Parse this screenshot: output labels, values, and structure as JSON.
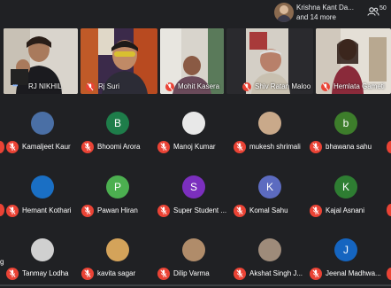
{
  "notification": {
    "title": "Krishna Kant Da...",
    "subtitle": "and 14 more"
  },
  "people_button": {
    "count": "50"
  },
  "video_tiles": [
    {
      "name": "RJ NIKHIL"
    },
    {
      "name": "Rj Suri"
    },
    {
      "name": "Mohit Kasera"
    },
    {
      "name": "Shiv Ratan Maloo"
    },
    {
      "name": "Hemlata Gameti"
    }
  ],
  "grid": [
    {
      "name": "Kamaljeet Kaur",
      "initial": "",
      "color": "#4a6fa5"
    },
    {
      "name": "Bhoomi Arora",
      "initial": "B",
      "color": "#1e7d4a"
    },
    {
      "name": "Manoj Kumar",
      "initial": "",
      "color": "#e8e8e8"
    },
    {
      "name": "mukesh shrimali",
      "initial": "",
      "color": "#c9a98a"
    },
    {
      "name": "bhawana sahu",
      "initial": "b",
      "color": "#3d7d2b"
    },
    {
      "name": "Hemant Kothari",
      "initial": "",
      "color": "#1a6fc4"
    },
    {
      "name": "Pawan Hiran",
      "initial": "P",
      "color": "#4caf50"
    },
    {
      "name": "Super Student ...",
      "initial": "S",
      "color": "#7b2fbe"
    },
    {
      "name": "Komal Sahu",
      "initial": "K",
      "color": "#5c6bc0"
    },
    {
      "name": "Kajal Asnani",
      "initial": "K",
      "color": "#2e7d32"
    },
    {
      "name": "Tanmay Lodha",
      "initial": "",
      "color": "#d0d0d0"
    },
    {
      "name": "kavita sagar",
      "initial": "",
      "color": "#d4a35a"
    },
    {
      "name": "Dilip Varma",
      "initial": "",
      "color": "#b08c6a"
    },
    {
      "name": "Akshat Singh J...",
      "initial": "",
      "color": "#9e8b7a"
    },
    {
      "name": "Jeenal Madhwa...",
      "initial": "J",
      "color": "#1565c0"
    }
  ],
  "edge_text": "g"
}
